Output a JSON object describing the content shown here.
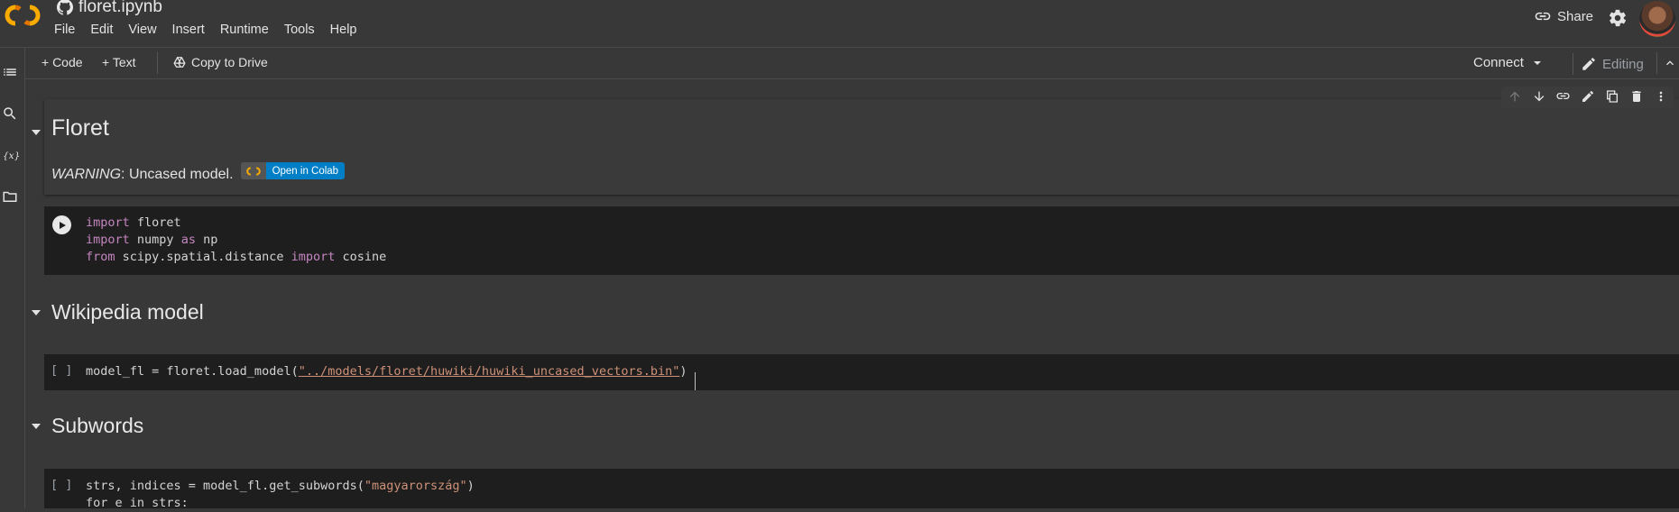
{
  "header": {
    "notebook_title": "floret.ipynb",
    "menu": [
      "File",
      "Edit",
      "View",
      "Insert",
      "Runtime",
      "Tools",
      "Help"
    ],
    "share_label": "Share"
  },
  "toolbar": {
    "code_label": "+ Code",
    "text_label": "+ Text",
    "copy_label": "Copy to Drive",
    "connect_label": "Connect",
    "editing_label": "Editing"
  },
  "cells": {
    "floret": {
      "heading": "Floret",
      "warning_em": "WARNING",
      "warning_rest": ": Uncased model.",
      "badge_label": "Open in Colab"
    },
    "imports": {
      "lines": [
        [
          {
            "t": "import",
            "k": "kw"
          },
          {
            "t": " floret",
            "k": ""
          }
        ],
        [
          {
            "t": "import",
            "k": "kw"
          },
          {
            "t": " numpy ",
            "k": ""
          },
          {
            "t": "as",
            "k": "kw"
          },
          {
            "t": " np",
            "k": ""
          }
        ],
        [
          {
            "t": "from",
            "k": "kw"
          },
          {
            "t": " scipy.spatial.distance ",
            "k": ""
          },
          {
            "t": "import",
            "k": "kw"
          },
          {
            "t": " cosine",
            "k": ""
          }
        ]
      ]
    },
    "wikipedia": {
      "heading": "Wikipedia model",
      "bracket": "[ ]",
      "code_prefix": "model_fl = floret.load_model(",
      "code_string": "\"../models/floret/huwiki/huwiki_uncased_vectors.bin\"",
      "code_suffix": ")"
    },
    "subwords": {
      "heading": "Subwords",
      "bracket": "[ ]",
      "line1_prefix": "strs, indices = model_fl.get_subwords(",
      "line1_string": "\"magyarország\"",
      "line1_suffix": ")",
      "line2": "for e in strs:"
    }
  },
  "icons": [
    "colab-logo",
    "github-icon",
    "link-icon",
    "gear-icon",
    "toc-icon",
    "search-icon",
    "variables-icon",
    "folder-icon",
    "drive-icon",
    "pencil-icon"
  ],
  "colors": {
    "background": "#383838",
    "code_background": "#1e1e1e",
    "keyword": "#c586c0",
    "string": "#ce9178",
    "badge": "#007ec6"
  }
}
